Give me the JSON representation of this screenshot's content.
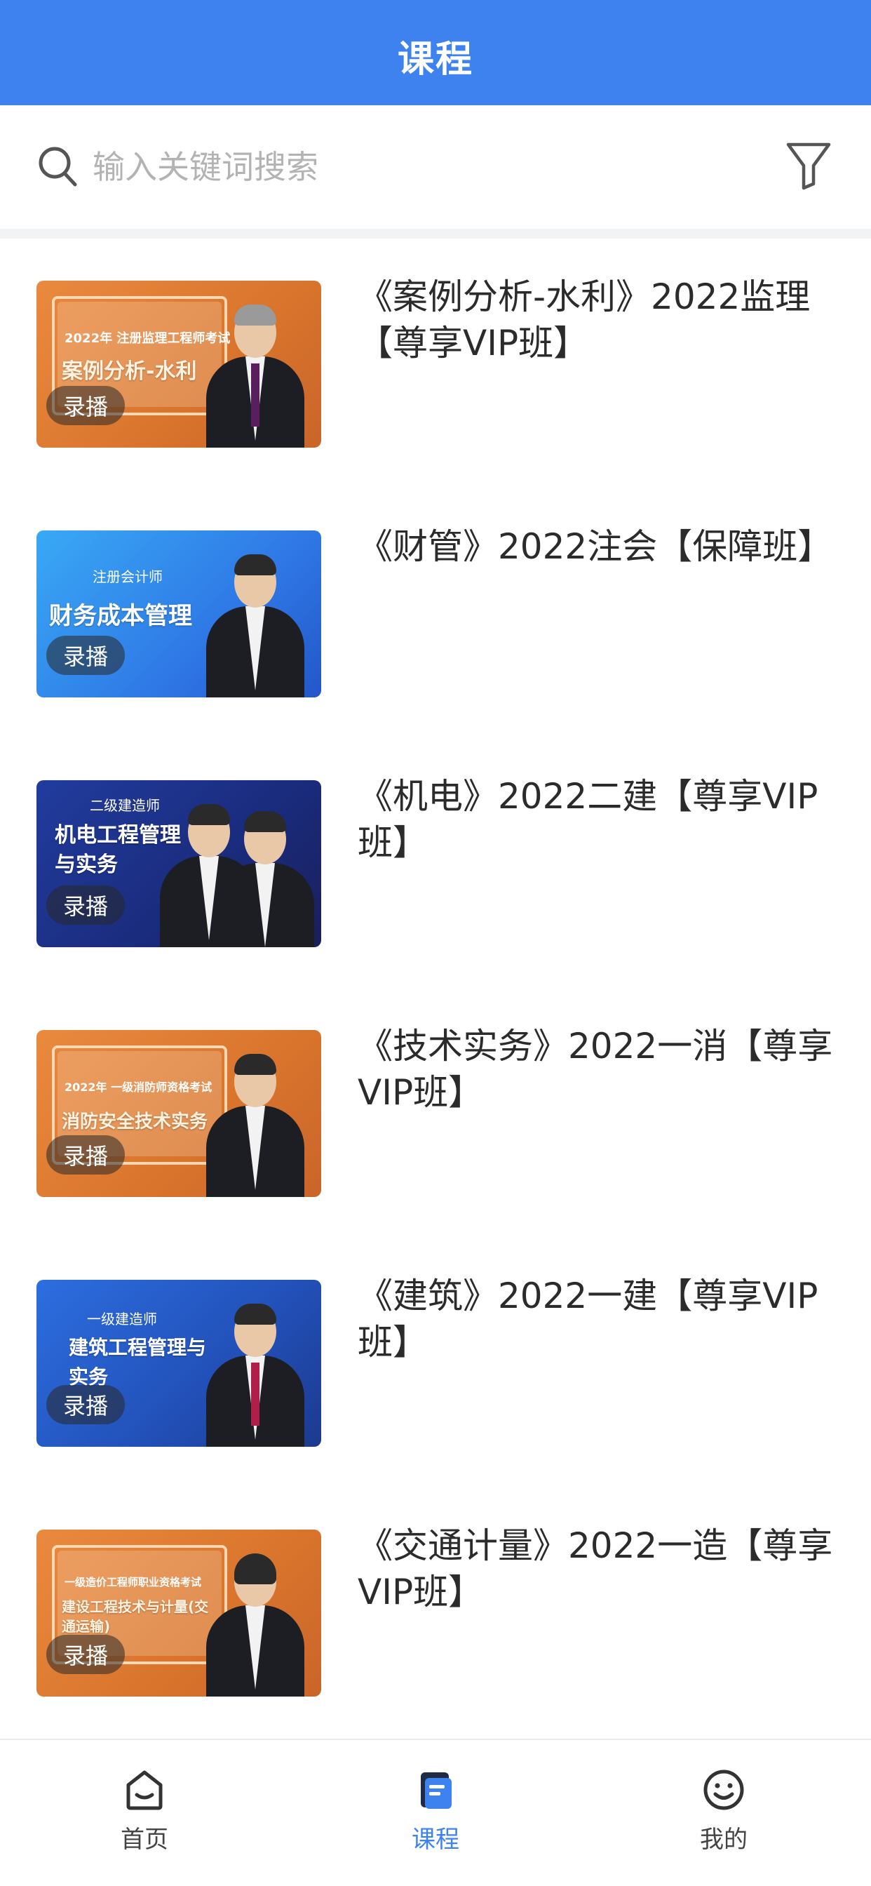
{
  "header": {
    "title": "课程"
  },
  "search": {
    "placeholder": "输入关键词搜索"
  },
  "courses": [
    {
      "title": "《案例分析-水利》2022监理【尊享VIP班】",
      "badge": "录播",
      "thumb_line1": "2022年 注册监理工程师考试",
      "thumb_line2": "案例分析-水利",
      "theme": "orange"
    },
    {
      "title": "《财管》2022注会【保障班】",
      "badge": "录播",
      "thumb_line1": "注册会计师",
      "thumb_line2": "财务成本管理",
      "theme": "blue"
    },
    {
      "title": "《机电》2022二建【尊享VIP班】",
      "badge": "录播",
      "thumb_line1": "二级建造师",
      "thumb_line2": "机电工程管理与实务",
      "theme": "navy"
    },
    {
      "title": "《技术实务》2022一消【尊享VIP班】",
      "badge": "录播",
      "thumb_line1": "2022年 一级消防师资格考试",
      "thumb_line2": "消防安全技术实务",
      "theme": "orange"
    },
    {
      "title": "《建筑》2022一建【尊享VIP班】",
      "badge": "录播",
      "thumb_line1": "一级建造师",
      "thumb_line2": "建筑工程管理与实务",
      "theme": "royal"
    },
    {
      "title": "《交通计量》2022一造【尊享VIP班】",
      "badge": "录播",
      "thumb_line1": "一级造价工程师职业资格考试",
      "thumb_line2": "建设工程技术与计量(交通运输)",
      "theme": "orange"
    }
  ],
  "tabs": [
    {
      "label": "首页",
      "icon": "home-icon"
    },
    {
      "label": "课程",
      "icon": "book-icon",
      "active": true
    },
    {
      "label": "我的",
      "icon": "smile-icon"
    }
  ],
  "colors": {
    "primary": "#3d82ef",
    "placeholder": "#b3b3b3"
  }
}
